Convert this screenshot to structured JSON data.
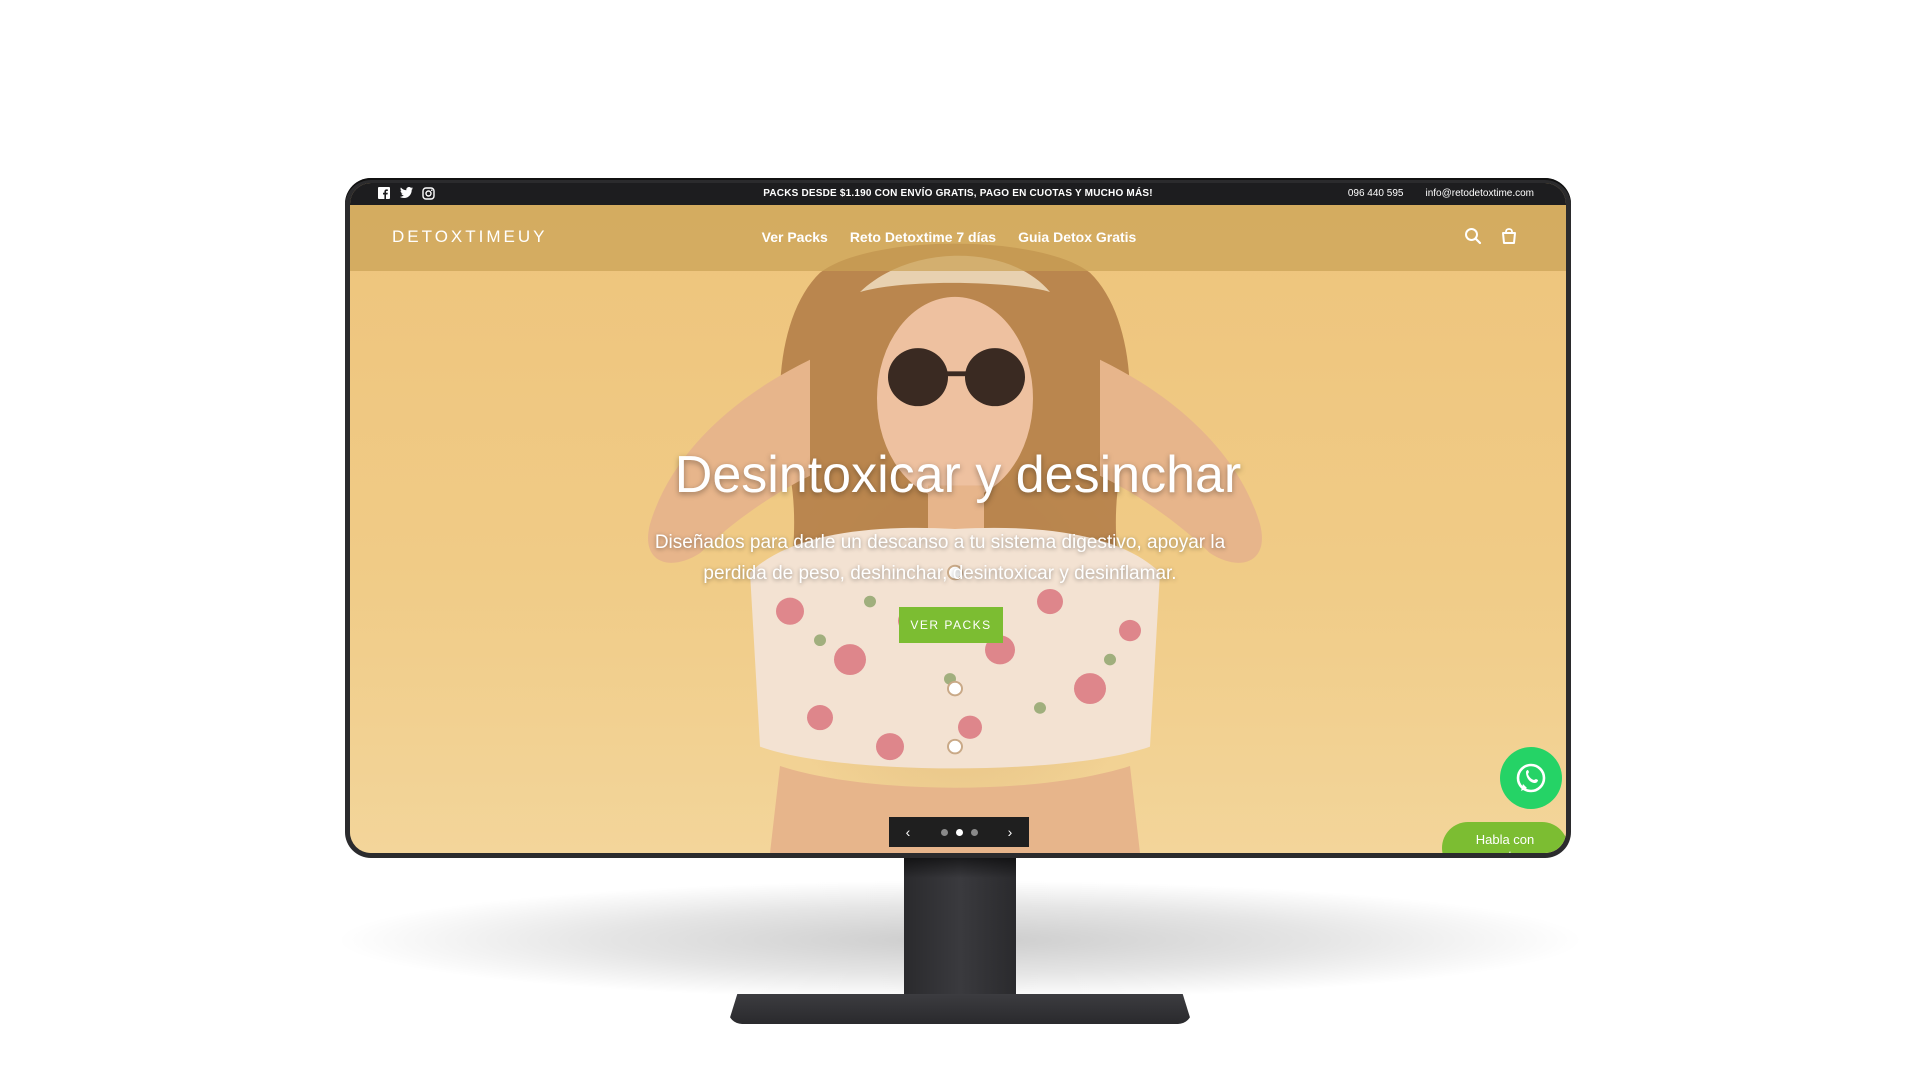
{
  "announcement": {
    "promo": "PACKS DESDE $1.190 CON ENVÍO GRATIS, PAGO EN CUOTAS Y MUCHO MÁS!",
    "phone": "096 440 595",
    "email": "info@retodetoxtime.com",
    "socials": [
      "facebook-icon",
      "twitter-icon",
      "instagram-icon"
    ]
  },
  "header": {
    "logo": "DETOXTIMEUY",
    "nav": [
      "Ver Packs",
      "Reto Detoxtime 7 días",
      "Guia Detox Gratis"
    ],
    "icons": [
      "search-icon",
      "cart-icon"
    ]
  },
  "hero": {
    "title": "Desintoxicar y desinchar",
    "subtitle": "Diseñados para darle un descanso a tu sistema digestivo, apoyar la perdida de peso, deshinchar, desintoxicar y desinflamar.",
    "cta": "VER PACKS",
    "slides_total": 3,
    "active_slide": 2
  },
  "whatsapp": {
    "label": "Habla con nosotros"
  },
  "colors": {
    "accent": "#7cbd32",
    "whatsapp": "#25d366",
    "announcement_bg": "#1d1d1f",
    "hero_bg": "#f0c982"
  }
}
